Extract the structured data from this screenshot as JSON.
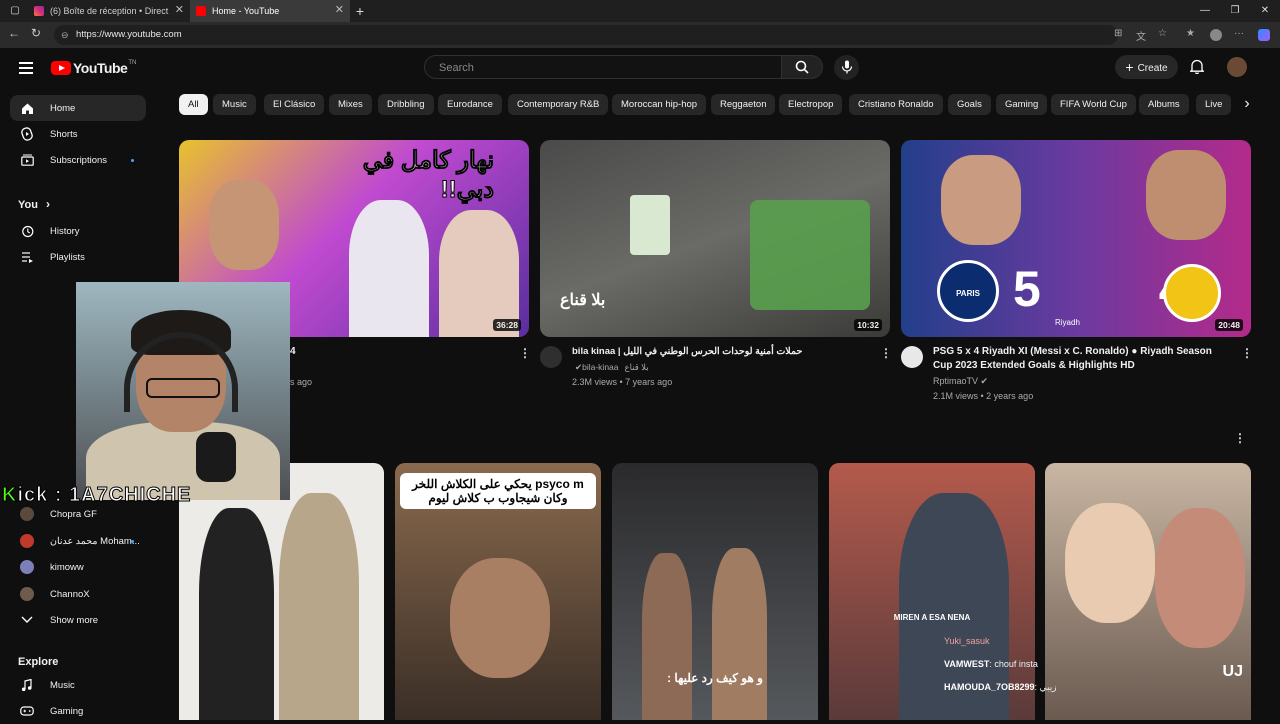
{
  "browser": {
    "tabs": [
      {
        "title": "(6) Boîte de réception • Direct",
        "active": false
      },
      {
        "title": "Home - YouTube",
        "active": true
      }
    ],
    "new_tab": "+",
    "url": "https://www.youtube.com"
  },
  "header": {
    "logo": "YouTube",
    "logo_tm": "TN",
    "search_placeholder": "Search",
    "create_label": "Create"
  },
  "sidebar": {
    "main": [
      {
        "label": "Home",
        "icon": "home-icon",
        "active": true
      },
      {
        "label": "Shorts",
        "icon": "shorts-icon"
      },
      {
        "label": "Subscriptions",
        "icon": "subscriptions-icon"
      }
    ],
    "you_label": "You",
    "you_chevron": "›",
    "you": [
      {
        "label": "History",
        "icon": "history-icon"
      },
      {
        "label": "Playlists",
        "icon": "playlists-icon"
      }
    ],
    "subscriptions": [
      {
        "label": "Chopra GF"
      },
      {
        "label": "محمد عدنان Moham..."
      },
      {
        "label": "kimoww"
      },
      {
        "label": "ChannoX"
      }
    ],
    "show_more": "Show more",
    "explore_label": "Explore",
    "explore": [
      {
        "label": "Music",
        "icon": "music-icon"
      },
      {
        "label": "Gaming",
        "icon": "gaming-icon"
      }
    ]
  },
  "chips": [
    "All",
    "Music",
    "El Clásico",
    "Mixes",
    "Dribbling",
    "Eurodance",
    "Contemporary R&B",
    "Moroccan hip-hop",
    "Reggaeton",
    "Electropop",
    "Cristiano Ronaldo",
    "Goals",
    "Gaming",
    "FIFA World Cup",
    "Albums",
    "Live"
  ],
  "chips_next": "›",
  "videos": [
    {
      "duration": "36:28",
      "title_fragment": "4",
      "meta_fragment": "s ago",
      "thumb_text": "نهار كامل في دبي!!"
    },
    {
      "duration": "10:32",
      "title": "bila kinaa | حملات أمنية لوحدات الحرس الوطني في الليل",
      "channel_ar": "بلا قناع",
      "channel": "bila-kinaa",
      "meta": "2.3M views • 7 years ago",
      "thumb_text": "بلا قناع"
    },
    {
      "duration": "20:48",
      "title": "PSG 5 x 4 Riyadh XI (Messi x C. Ronaldo) ● Riyadh Season Cup 2023 Extended Goals & Highlights HD",
      "channel": "RptimaoTV",
      "meta": "2.1M views • 2 years ago",
      "score": "5 4",
      "badge_left": "PARIS",
      "badge_mid": "Riyadh"
    }
  ],
  "shorts": [
    {
      "thumb": "couple"
    },
    {
      "caption": "psyco m يحكي على الكلاش اللخر وكان شيجاوب ب كلاش ليوم"
    },
    {
      "caption": "و هو كيف رد عليها :"
    },
    {
      "caption": "MIREN A ESA NENA"
    },
    {
      "caption": "UJ"
    }
  ],
  "overlay": {
    "kick": "Kick : 1A7CHICHE",
    "chat": [
      {
        "user": "Yuki_sasuk",
        "msg": ""
      },
      {
        "user": "VAMWEST",
        "msg": ": chouf insta"
      },
      {
        "user": "HAMOUDA_7OB8299",
        "msg": ": زيبي"
      }
    ]
  },
  "colors": {
    "background": "#0f0f0f",
    "youtube_red": "#ff0000",
    "chip": "#272727",
    "kick_green": "#53fc18"
  }
}
